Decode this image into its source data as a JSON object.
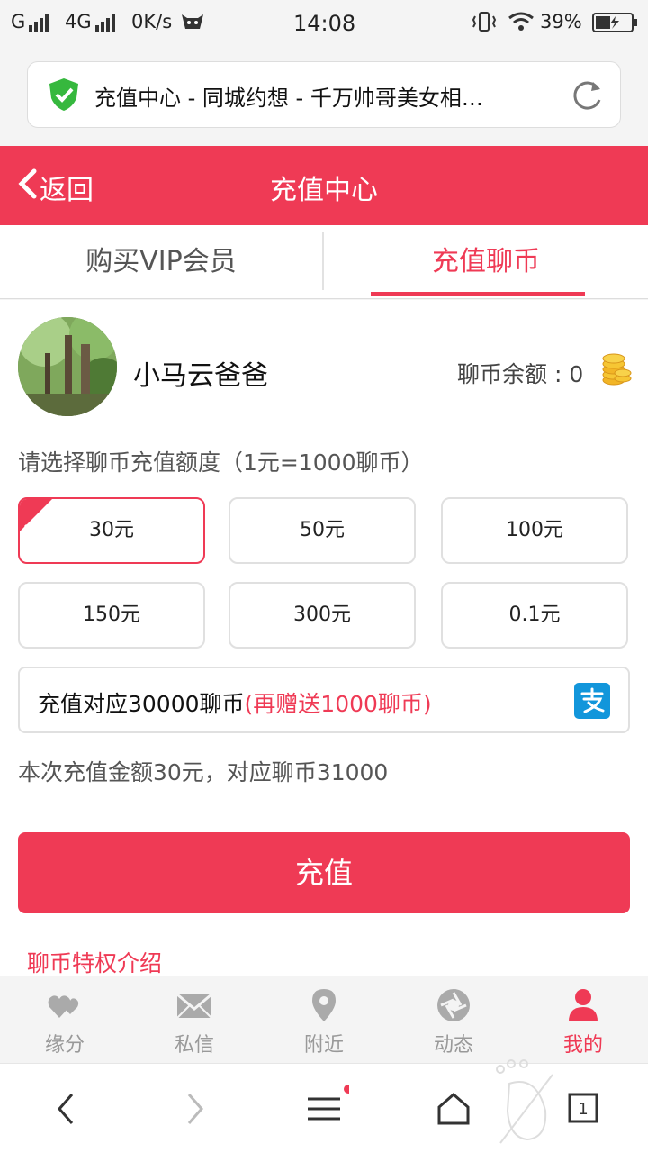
{
  "status_bar": {
    "carrier1": "G",
    "carrier2": "4G",
    "speed": "0K/s",
    "time": "14:08",
    "battery": "39%"
  },
  "browser": {
    "page_title": "充值中心 - 同城约想 - 千万帅哥美女相…",
    "tab_count": "1"
  },
  "header": {
    "back_label": "返回",
    "title": "充值中心"
  },
  "tabs": [
    {
      "label": "购买VIP会员"
    },
    {
      "label": "充值聊币"
    }
  ],
  "user": {
    "name": "小马云爸爸",
    "balance_label": "聊币余额 : 0"
  },
  "recharge": {
    "prompt": "请选择聊币充值额度（1元=1000聊币）",
    "options": [
      {
        "label": "30元"
      },
      {
        "label": "50元"
      },
      {
        "label": "100元"
      },
      {
        "label": "150元"
      },
      {
        "label": "300元"
      },
      {
        "label": "0.1元"
      }
    ],
    "info_text": "充值对应30000聊币",
    "bonus_text": "(再赠送1000聊币)",
    "summary": "本次充值金额30元，对应聊币31000",
    "pay_label": "充值",
    "privilege_link": "聊币特权介绍"
  },
  "app_nav": [
    {
      "label": "缘分",
      "icon": "hearts-icon"
    },
    {
      "label": "私信",
      "icon": "envelope-icon"
    },
    {
      "label": "附近",
      "icon": "location-pin-icon"
    },
    {
      "label": "动态",
      "icon": "aperture-icon"
    },
    {
      "label": "我的",
      "icon": "person-icon"
    }
  ],
  "colors": {
    "accent": "#ef3a55",
    "nav_inactive": "#999999"
  }
}
